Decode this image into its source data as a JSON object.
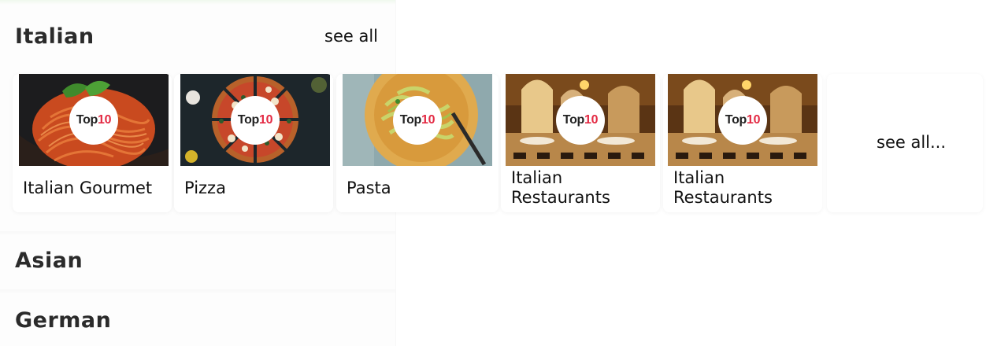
{
  "sections": [
    {
      "title": "Italian",
      "see_all": "see all"
    },
    {
      "title": "Asian"
    },
    {
      "title": "German"
    }
  ],
  "cards": [
    {
      "label": "Italian Gourmet",
      "badge_a": "Top",
      "badge_b": "10",
      "image": "spaghetti-plate"
    },
    {
      "label": "Pizza",
      "badge_a": "Top",
      "badge_b": "10",
      "image": "pizza"
    },
    {
      "label": "Pasta",
      "badge_a": "Top",
      "badge_b": "10",
      "image": "pasta-bowl"
    },
    {
      "label": "Italian Restaurants",
      "badge_a": "Top",
      "badge_b": "10",
      "image": "restaurant-interior"
    },
    {
      "label": "Italian Restaurants",
      "badge_a": "Top",
      "badge_b": "10",
      "image": "restaurant-interior"
    }
  ],
  "see_all_card": "see all...",
  "colors": {
    "badge_accent": "#e32a43",
    "title_text": "#2b2b2b"
  }
}
